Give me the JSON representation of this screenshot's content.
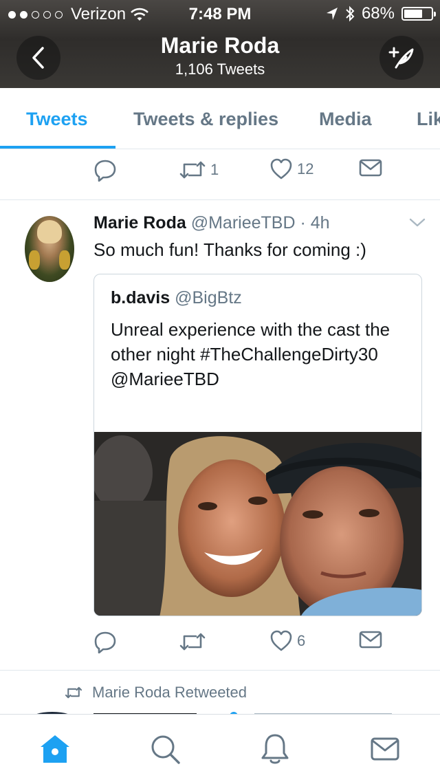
{
  "status_bar": {
    "carrier": "Verizon",
    "time": "7:48 PM",
    "battery": "68%",
    "battery_level": 0.68,
    "signal_bars_filled": 2,
    "signal_bars_total": 5
  },
  "header": {
    "name": "Marie Roda",
    "tweet_count": "1,106 Tweets"
  },
  "tabs": [
    {
      "label": "Tweets",
      "active": true
    },
    {
      "label": "Tweets & replies",
      "active": false
    },
    {
      "label": "Media",
      "active": false
    },
    {
      "label": "Lik",
      "active": false
    }
  ],
  "prev_tweet_actions": {
    "retweets": "1",
    "likes": "12"
  },
  "tweet": {
    "name": "Marie Roda",
    "handle": "@MarieeTBD",
    "time": " · 4h",
    "text": "So much fun! Thanks for coming :)",
    "quote": {
      "name": "b.davis",
      "handle": "@BigBtz",
      "text": "Unreal experience with the cast the other night #TheChallengeDirty30 @MarieeTBD"
    },
    "likes": "6"
  },
  "retweeted_label": "Marie Roda Retweeted",
  "colors": {
    "accent": "#1da1f2",
    "secondary_text": "#657786",
    "divider": "#e1e8ed"
  },
  "bottom_nav": [
    "home-icon",
    "search-icon",
    "notifications-icon",
    "messages-icon"
  ]
}
